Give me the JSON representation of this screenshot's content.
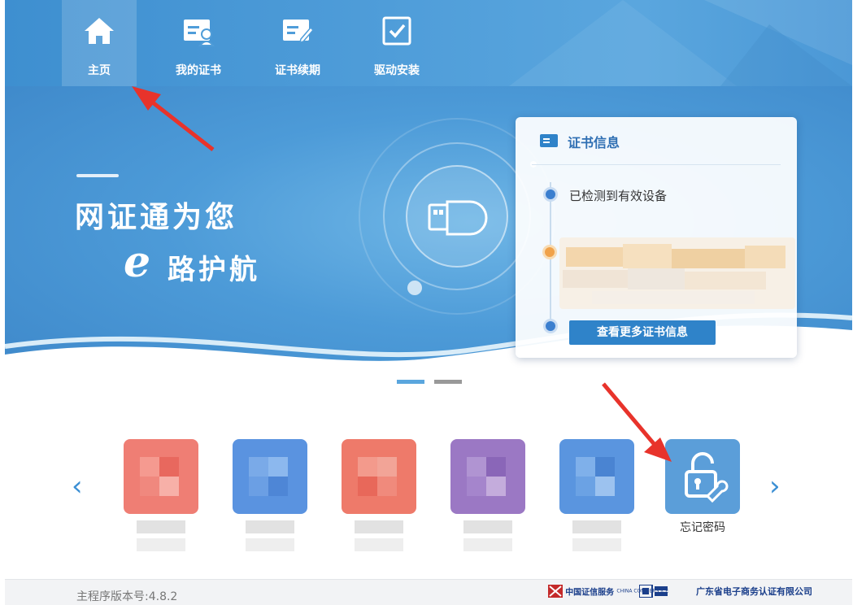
{
  "nav": {
    "items": [
      {
        "label": "主页",
        "icon": "home-icon",
        "active": true
      },
      {
        "label": "我的证书",
        "icon": "certificate-user-icon",
        "active": false
      },
      {
        "label": "证书续期",
        "icon": "certificate-renew-icon",
        "active": false
      },
      {
        "label": "驱动安装",
        "icon": "driver-install-icon",
        "active": false
      }
    ]
  },
  "banner": {
    "slogan_line1": "网证通为您",
    "slogan_e": "e",
    "slogan_line2": "路护航",
    "device_icon": "usb-key-icon"
  },
  "cert_info": {
    "title": "证书信息",
    "status": "已检测到有效设备",
    "more_button": "查看更多证书信息"
  },
  "tools": {
    "prev_arrow": "‹",
    "next_arrow": "›",
    "forgot_password_label": "忘记密码",
    "forgot_password_icon": "lock-wrench-icon"
  },
  "footer": {
    "version": "主程序版本号:4.8.2",
    "logo1": "中国证信服务",
    "logo1_sub": "CHINA COMMERS ICE",
    "logo3": "广东省电子商务认证有限公司"
  },
  "colors": {
    "header_blue": "#4f9dd9",
    "accent_blue": "#2f83c9",
    "annotation_red": "#e8332b"
  }
}
